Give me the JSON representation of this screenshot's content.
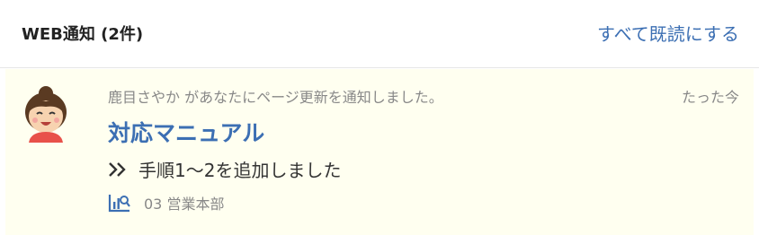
{
  "header": {
    "title": "WEB通知 (2件)",
    "mark_all_read": "すべて既読にする"
  },
  "notification": {
    "message": "鹿目さやか があなたにページ更新を通知しました。",
    "time": "たった今",
    "page_title": "対応マニュアル",
    "change_text": "手順1〜2を追加しました",
    "space": "03 営業本部",
    "avatar_icon": "user-avatar-icon",
    "change_icon": "double-chevron-right-icon",
    "space_icon": "chart-search-icon"
  },
  "colors": {
    "accent": "#3c6fb3",
    "item_background": "#fffff0",
    "muted_text": "#888888"
  }
}
